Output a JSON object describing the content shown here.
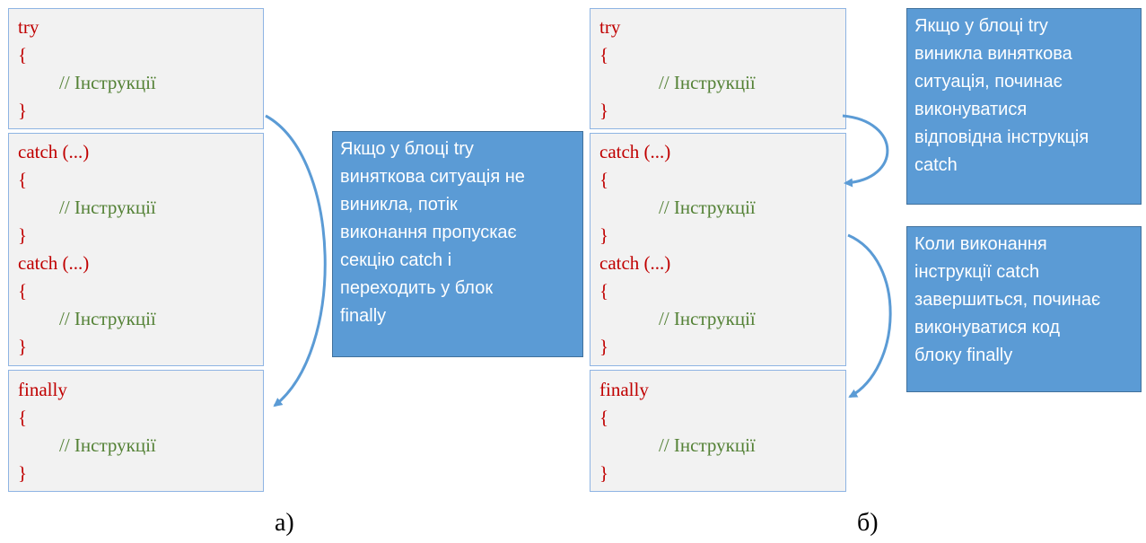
{
  "left": {
    "try_block": {
      "keyword": "try",
      "open": "{",
      "comment": "// Інструкції",
      "close": "}"
    },
    "catch_block": {
      "catch1": "catch (...)",
      "open1": "{",
      "comment1": "// Інструкції",
      "close1": "}",
      "catch2": "catch (...)",
      "open2": "{",
      "comment2": "// Інструкції",
      "close2": "}"
    },
    "finally_block": {
      "keyword": "finally",
      "open": "{",
      "comment": "// Інструкції",
      "close": "}"
    },
    "callout": "Якщо у блоці try\nвиняткова ситуація не\nвиникла, потік\nвиконання пропускає\nсекцію catch і\nпереходить у блок\nfinally",
    "caption": "а)"
  },
  "right": {
    "try_block": {
      "keyword": "try",
      "open": "{",
      "comment": "// Інструкції",
      "close": "}"
    },
    "catch_block": {
      "catch1": "catch (...)",
      "open1": "{",
      "comment1": "// Інструкції",
      "close1": "}",
      "catch2": "catch (...)",
      "open2": "{",
      "comment2": "// Інструкції",
      "close2": "}"
    },
    "finally_block": {
      "keyword": "finally",
      "open": "{",
      "comment": "// Інструкції",
      "close": "}"
    },
    "callout_top": "Якщо у блоці try\nвиникла виняткова\nситуація, починає\nвиконуватися\nвідповідна інструкція\ncatch",
    "callout_bottom": "Коли виконання\nінструкції catch\nзавершиться, починає\nвиконуватися код\nблоку finally",
    "caption": "б)"
  },
  "colors": {
    "keyword": "#c00000",
    "comment": "#538135",
    "code_bg": "#f2f2f2",
    "box_border": "#8eb4e3",
    "callout_bg": "#5b9bd5",
    "arrow": "#5b9bd5"
  }
}
